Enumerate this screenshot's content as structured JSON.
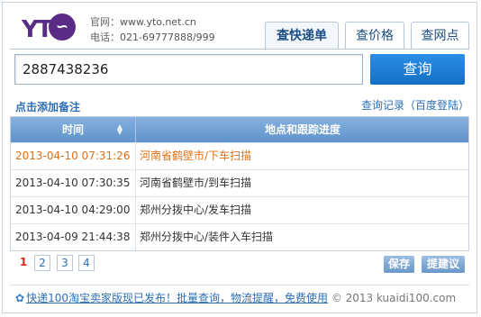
{
  "logo": {
    "text": "YT",
    "mark": "ⓢ"
  },
  "site": {
    "website_label": "官网：",
    "website": "www.yto.net.cn",
    "phone_label": "电话：",
    "phone": "021-69777888/999"
  },
  "tabs": [
    "查快递单",
    "查价格",
    "查网点"
  ],
  "search": {
    "value": "2887438236",
    "button": "查询"
  },
  "links": {
    "add_note": "点击添加备注",
    "history": "查询记录（百度登陆）"
  },
  "table": {
    "headers": {
      "time": "时间",
      "location": "地点和跟踪进度"
    },
    "rows": [
      {
        "time": "2013-04-10 07:31:26",
        "location": "河南省鹤壁市/下车扫描"
      },
      {
        "time": "2013-04-10 07:30:35",
        "location": "河南省鹤壁市/到车扫描"
      },
      {
        "time": "2013-04-10 04:29:00",
        "location": "郑州分拨中心/发车扫描"
      },
      {
        "time": "2013-04-09 21:44:38",
        "location": "郑州分拨中心/装件入车扫描"
      }
    ]
  },
  "pagination": [
    "1",
    "2",
    "3",
    "4"
  ],
  "actions": {
    "save": "保存",
    "suggest": "提建议"
  },
  "footer": {
    "promo": "快递100淘宝卖家版现已发布！批量查询，物流提醒，免费使用",
    "copyright": "© 2013 kuaidi100.com"
  },
  "colors": {
    "accent": "#1a7ed8",
    "header": "#6d9ed3",
    "latest": "#e07016",
    "brand": "#5b2c86"
  }
}
